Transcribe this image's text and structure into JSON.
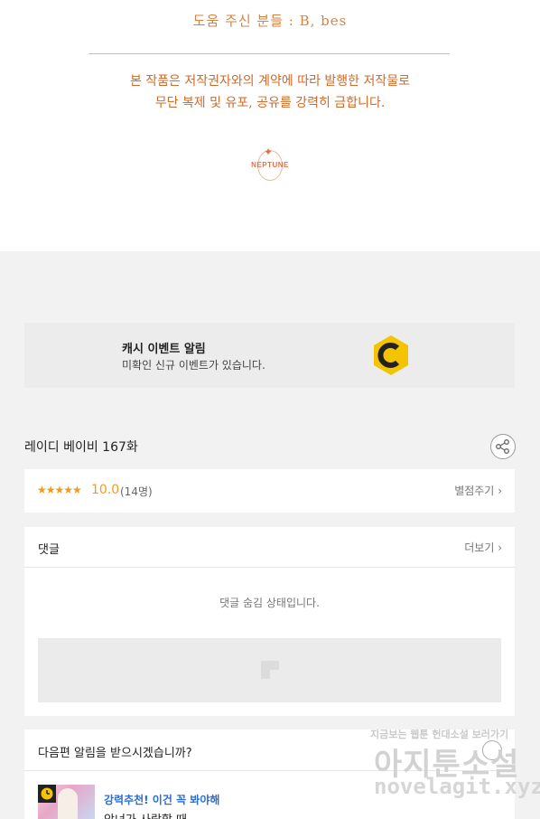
{
  "credits": {
    "helpers": "도움 주신 분들 : B, bes",
    "notice_line1": "본 작품은 저작권자와의 계약에 따라 발행한 저작물로",
    "notice_line2": "무단 복제 및 유포, 공유를 강력히 금합니다.",
    "logo_text": "NEPTUNE"
  },
  "cash_event": {
    "title": "캐시 이벤트 알림",
    "description": "미확인 신규 이벤트가 있습니다.",
    "icon": "cash-coin-icon"
  },
  "episode": {
    "title": "레이디 베이비 167화",
    "share_icon": "share-icon"
  },
  "rating": {
    "stars": "★★★★★",
    "score": "10.0",
    "count": "(14명)",
    "rate_button": "별점주기"
  },
  "comments": {
    "label": "댓글",
    "more_button": "더보기",
    "hidden_message": "댓글 숨김 상태입니다."
  },
  "next_episode": {
    "question": "다음편 알림을 받으시겠습니까?",
    "recommend_tag": "강력추천! 이건 꼭 봐야해",
    "recommend_title": "악녀가 사랑할 때"
  },
  "watermark": {
    "top_text": "지금보는 웹툰 헌대소설 보러가기",
    "main_text": "아지툰소설",
    "url": "novelagit.xyz"
  },
  "colors": {
    "credit_orange": "#d06a2a",
    "star_orange": "#f29b1a",
    "cash_yellow": "#f5c400",
    "link_blue": "#2c6ed5"
  }
}
